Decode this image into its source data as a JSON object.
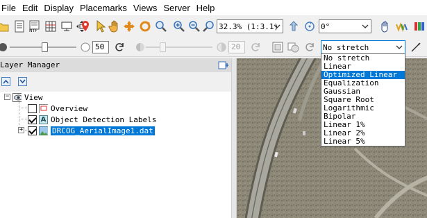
{
  "menu": [
    "File",
    "Edit",
    "Display",
    "Placemarks",
    "Views",
    "Server",
    "Help"
  ],
  "toolbar": {
    "zoom_value": "32.3% (1:3.1)",
    "rotation_value": "0°",
    "stretch_value": "No stretch",
    "brightness_value": "50",
    "contrast_value": "20"
  },
  "stretch_options": [
    "No stretch",
    "Linear",
    "Optimized Linear",
    "Equalization",
    "Gaussian",
    "Square Root",
    "Logarithmic",
    "Bipolar",
    "Linear 1%",
    "Linear 2%",
    "Linear 5%"
  ],
  "stretch_highlighted": "Optimized Linear",
  "layer_manager": {
    "title": "Layer Manager",
    "root": "View",
    "layers": [
      {
        "name": "Overview",
        "checked": false,
        "icon": "overview-icon"
      },
      {
        "name": "Object Detection Labels",
        "checked": true,
        "icon": "annotation-icon",
        "icon_letter": "A"
      },
      {
        "name": "DRCOG_AerialImage1.dat",
        "checked": true,
        "icon": "raster-icon",
        "selected": true
      }
    ]
  },
  "colors": {
    "selection": "#0078d7",
    "map_ground": "#8a8574",
    "road": "#a9a89f"
  }
}
